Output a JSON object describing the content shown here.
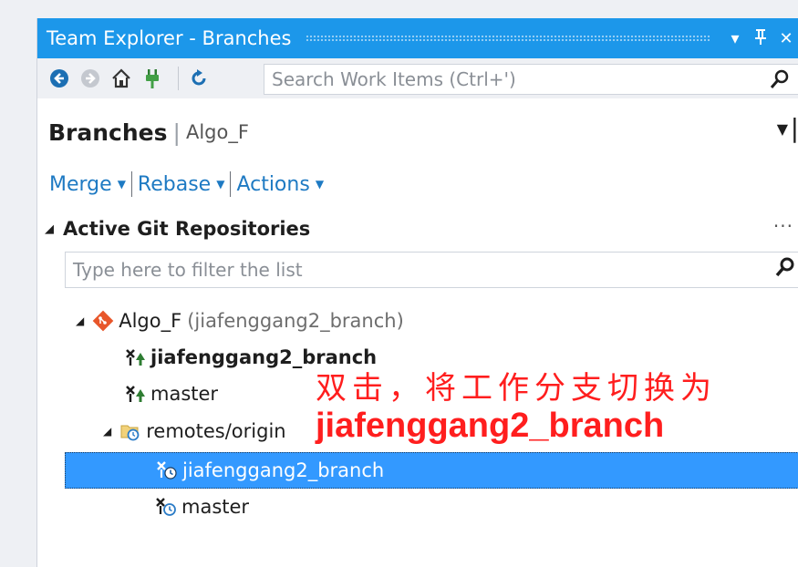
{
  "window": {
    "title": "Team Explorer - Branches",
    "controls": {
      "dropdown": "▾",
      "pin": "ᵽ",
      "close": "✕"
    }
  },
  "toolbar": {
    "icons": [
      "back-icon",
      "forward-icon",
      "home-icon",
      "connect-icon",
      "refresh-icon"
    ],
    "search_placeholder": "Search Work Items (Ctrl+')",
    "search_icon": "⚲"
  },
  "page": {
    "title": "Branches",
    "subtitle": "Algo_F"
  },
  "actions": {
    "merge": "Merge",
    "rebase": "Rebase",
    "actions": "Actions"
  },
  "section": {
    "title": "Active Git Repositories",
    "more": "···"
  },
  "filter": {
    "placeholder": "Type here to filter the list"
  },
  "tree": {
    "repo_name": "Algo_F",
    "repo_branch": "(jiafenggang2_branch)",
    "local_branches": [
      "jiafenggang2_branch",
      "master"
    ],
    "remotes_label": "remotes/origin",
    "remote_branches": [
      "jiafenggang2_branch",
      "master"
    ],
    "current_branch_index": 0,
    "selected_remote_index": 0
  },
  "annotation": {
    "line1": "双击，将工作分支切换为",
    "line2": "jiafenggang2_branch",
    "color": "#ff1e1e"
  },
  "colors": {
    "accent": "#1c97ea",
    "link": "#1e7ac3",
    "selection": "#3399ff"
  }
}
